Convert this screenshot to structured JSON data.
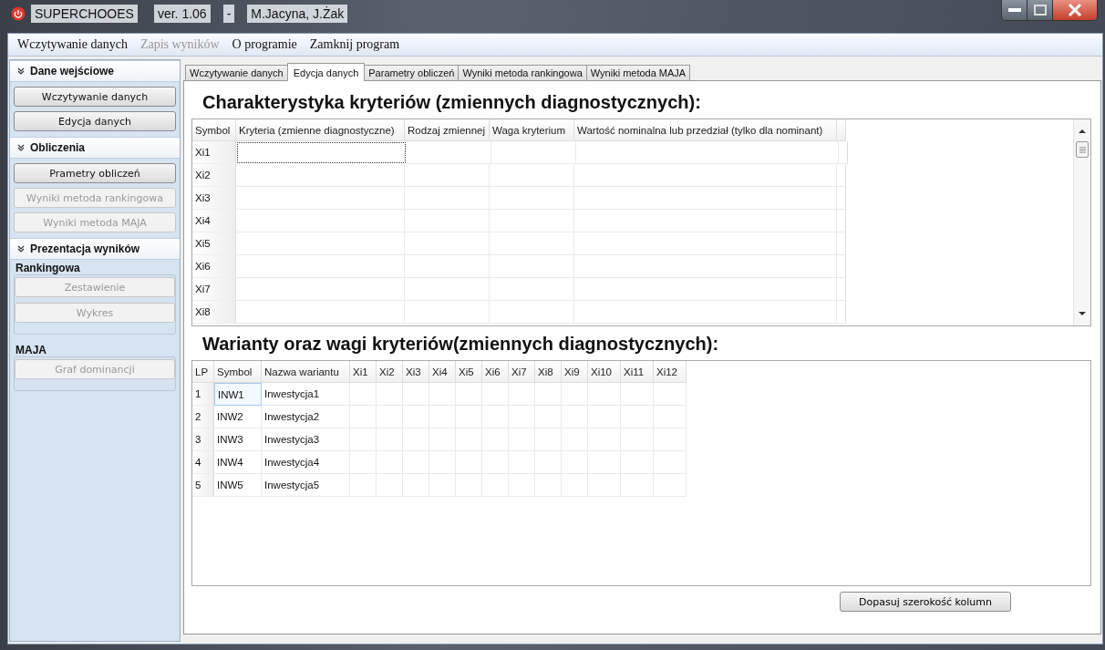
{
  "window": {
    "title": "SUPERCHOOES",
    "version": "ver. 1.06",
    "separator": "-",
    "authors": "M.Jacyna, J.Żak"
  },
  "menu": [
    {
      "label": "Wczytywanie danych",
      "disabled": false
    },
    {
      "label": "Zapis wyników",
      "disabled": true
    },
    {
      "label": "O programie",
      "disabled": false
    },
    {
      "label": "Zamknij program",
      "disabled": false
    }
  ],
  "sidebar": {
    "sections": [
      {
        "title": "Dane wejściowe",
        "buttons": [
          {
            "label": "Wczytywanie danych",
            "disabled": false
          },
          {
            "label": "Edycja danych",
            "disabled": false
          }
        ]
      },
      {
        "title": "Obliczenia",
        "buttons": [
          {
            "label": "Prametry obliczeń",
            "disabled": false
          },
          {
            "label": "Wyniki metoda rankingowa",
            "disabled": true
          },
          {
            "label": "Wyniki metoda MAJA",
            "disabled": true
          }
        ]
      },
      {
        "title": "Prezentacja wyników",
        "groups": [
          {
            "title": "Rankingowa",
            "buttons": [
              {
                "label": "Zestawienie",
                "disabled": true
              },
              {
                "label": "Wykres",
                "disabled": true
              }
            ]
          },
          {
            "title": "MAJA",
            "buttons": [
              {
                "label": "Graf dominancji",
                "disabled": true
              }
            ]
          }
        ]
      }
    ]
  },
  "tabs": [
    {
      "label": "Wczytywanie danych",
      "selected": false
    },
    {
      "label": "Edycja danych",
      "selected": true
    },
    {
      "label": "Parametry obliczeń",
      "selected": false
    },
    {
      "label": "Wyniki metoda rankingowa",
      "selected": false
    },
    {
      "label": "Wyniki metoda MAJA",
      "selected": false
    }
  ],
  "criteria": {
    "title": "Charakterystyka kryteriów (zmiennych diagnostycznych):",
    "columns": [
      "Symbol",
      "Kryteria (zmienne diagnostyczne)",
      "Rodzaj zmiennej",
      "Waga kryterium",
      "Wartość nominalna lub przedział (tylko dla nominant)"
    ],
    "rows": [
      {
        "symbol": "Xi1",
        "focused": true
      },
      {
        "symbol": "Xi2",
        "focused": false
      },
      {
        "symbol": "Xi3",
        "focused": false
      },
      {
        "symbol": "Xi4",
        "focused": false
      },
      {
        "symbol": "Xi5",
        "focused": false
      },
      {
        "symbol": "Xi6",
        "focused": false
      },
      {
        "symbol": "Xi7",
        "focused": false
      },
      {
        "symbol": "Xi8",
        "focused": false
      }
    ]
  },
  "variants": {
    "title": "Warianty oraz wagi kryteriów(zmiennych diagnostycznych):",
    "columns": [
      "LP",
      "Symbol",
      "Nazwa wariantu",
      "Xi1",
      "Xi2",
      "Xi3",
      "Xi4",
      "Xi5",
      "Xi6",
      "Xi7",
      "Xi8",
      "Xi9",
      "Xi10",
      "Xi11",
      "Xi12"
    ],
    "rows": [
      {
        "lp": "1",
        "symbol": "INW1",
        "name": "Inwestycja1",
        "focused": true
      },
      {
        "lp": "2",
        "symbol": "INW2",
        "name": "Inwestycja2",
        "focused": false
      },
      {
        "lp": "3",
        "symbol": "INW3",
        "name": "Inwestycja3",
        "focused": false
      },
      {
        "lp": "4",
        "symbol": "INW4",
        "name": "Inwestycja4",
        "focused": false
      },
      {
        "lp": "5",
        "symbol": "INW5",
        "name": "Inwestycja5",
        "focused": false
      }
    ]
  },
  "fit_button": "Dopasuj szerokość kolumn"
}
